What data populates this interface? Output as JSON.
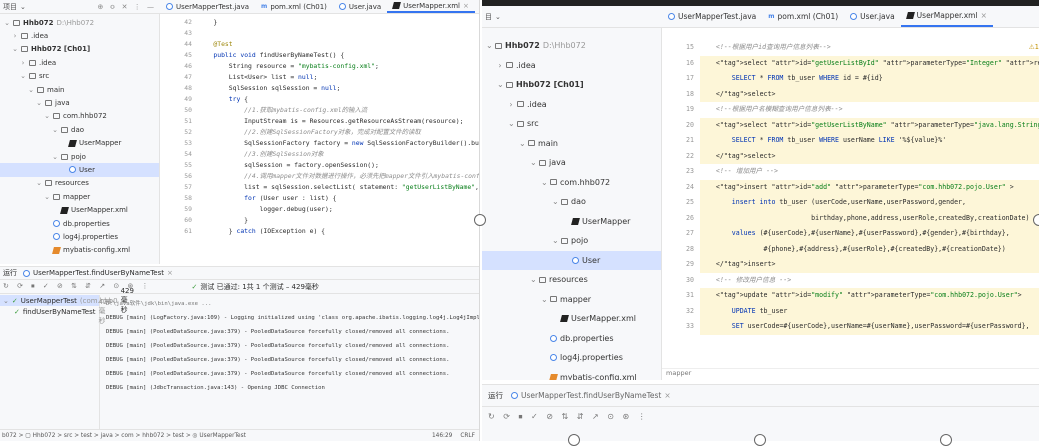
{
  "left": {
    "project_label": "项目",
    "tabs": [
      {
        "label": "UserMapperTest.java",
        "icon": "java-file-icon"
      },
      {
        "label": "pom.xml (Ch01)",
        "icon": "maven-icon"
      },
      {
        "label": "User.java",
        "icon": "java-file-icon"
      },
      {
        "label": "UserMapper.xml",
        "icon": "xml-file-icon"
      }
    ],
    "tree": [
      {
        "label": "Hhb072",
        "extra": "D:\\Hhb072"
      },
      {
        "label": ".idea"
      },
      {
        "label": "Hhb072 [Ch01]"
      },
      {
        "label": ".idea"
      },
      {
        "label": "src"
      },
      {
        "label": "main"
      },
      {
        "label": "java"
      },
      {
        "label": "com.hhb072"
      },
      {
        "label": "dao"
      },
      {
        "label": "UserMapper"
      },
      {
        "label": "pojo"
      },
      {
        "label": "User"
      },
      {
        "label": "resources"
      },
      {
        "label": "mapper"
      },
      {
        "label": "UserMapper.xml"
      },
      {
        "label": "db.properties"
      },
      {
        "label": "log4j.properties"
      },
      {
        "label": "mybatis-config.xml"
      }
    ],
    "gutter": [
      "42",
      "43",
      "44",
      "45",
      "46",
      "47",
      "48",
      "49",
      "50",
      "51",
      "52",
      "53",
      "54",
      "55",
      "56",
      "57",
      "58",
      "59",
      "60",
      "61"
    ],
    "code": [
      "    }",
      "",
      "    @Test",
      "    public void findUserByNameTest() {",
      "        String resource = \"mybatis-config.xml\";",
      "        List<User> list = null;",
      "        SqlSession sqlSession = null;",
      "        try {",
      "            //1.获取mybatis-config.xml的输入流",
      "            InputStream is = Resources.getResourceAsStream(resource);",
      "            //2.创建SqlSessionFactory对象，完成对配置文件的读取",
      "            SqlSessionFactory factory = new SqlSessionFactoryBuilder().build(is);",
      "            //3.创建SqlSession对象",
      "            sqlSession = factory.openSession();",
      "            //4.调用mapper文件对数据进行操作，必须先把mapper文件引入mybatis-config.xml中",
      "            list = sqlSession.selectList( statement: \"getUserListByName\",  parameter: \"张\");",
      "            for (User user : list) {",
      "                logger.debug(user);",
      "            }",
      "        } catch (IOException e) {"
    ],
    "run": {
      "label": "运行",
      "tab": "UserMapperTest.findUserByNameTest",
      "status": "测试 已通过: 1共 1 个测试 – 429毫秒",
      "suite": "UserMapperTest",
      "suite_pkg": "(com.hhb0",
      "suite_time": "429毫秒",
      "test": "findUserByNameTest",
      "test_time": "429毫秒",
      "console": [
        "D:\\java软件\\jdk\\bin\\java.exe ...",
        "DEBUG [main] (LogFactory.java:109) - Logging initialized using 'class org.apache.ibatis.logging.log4j.Log4jImpl' adapter.",
        "DEBUG [main] (PooledDataSource.java:379) - PooledDataSource forcefully closed/removed all connections.",
        "DEBUG [main] (PooledDataSource.java:379) - PooledDataSource forcefully closed/removed all connections.",
        "DEBUG [main] (PooledDataSource.java:379) - PooledDataSource forcefully closed/removed all connections.",
        "DEBUG [main] (PooledDataSource.java:379) - PooledDataSource forcefully closed/removed all connections.",
        "DEBUG [main] (JdbcTransaction.java:143) - Opening JDBC Connection"
      ]
    },
    "status_bar": {
      "path": "b072 > ▢ Hhb072 > src > test > java > com > hhb072 > test > ◎ UserMapperTest",
      "pos": "146:29",
      "enc": "CRLF"
    }
  },
  "right": {
    "project_label": "目",
    "tabs": [
      {
        "label": "UserMapperTest.java",
        "icon": "java-file-icon"
      },
      {
        "label": "pom.xml (Ch01)",
        "icon": "maven-icon"
      },
      {
        "label": "User.java",
        "icon": "java-file-icon"
      },
      {
        "label": "UserMapper.xml",
        "icon": "xml-file-icon"
      }
    ],
    "tree": [
      {
        "label": "Hhb072",
        "extra": "D:\\Hhb072"
      },
      {
        "label": ".idea"
      },
      {
        "label": "Hhb072 [Ch01]"
      },
      {
        "label": ".idea"
      },
      {
        "label": "src"
      },
      {
        "label": "main"
      },
      {
        "label": "java"
      },
      {
        "label": "com.hhb072"
      },
      {
        "label": "dao"
      },
      {
        "label": "UserMapper"
      },
      {
        "label": "pojo"
      },
      {
        "label": "User"
      },
      {
        "label": "resources"
      },
      {
        "label": "mapper"
      },
      {
        "label": "UserMapper.xml"
      },
      {
        "label": "db.properties"
      },
      {
        "label": "log4j.properties"
      },
      {
        "label": "mybatis-config.xml"
      }
    ],
    "gutter": [
      "15",
      "16",
      "17",
      "18",
      "19",
      "20",
      "21",
      "22",
      "23",
      "24",
      "25",
      "26",
      "27",
      "28",
      "29",
      "30",
      "31",
      "32",
      "33"
    ],
    "code": [
      "    <!--根据用户id查询用户信息列表-->",
      "    <select id=\"getUserListById\" parameterType=\"Integer\" resultType=\"com.hhb072.pojo.User\">",
      "        SELECT * FROM tb_user WHERE id = #{id}",
      "    </select>",
      "    <!--根据用户名模糊查询用户信息列表-->",
      "    <select id=\"getUserListByName\" parameterType=\"java.lang.String\" resultType=\"com.hhb072.pojo.User\">",
      "        SELECT * FROM tb_user WHERE userName LIKE '%${value}%'",
      "    </select>",
      "    <!-- 增加用户 -->",
      "    <insert id=\"add\" parameterType=\"com.hhb072.pojo.User\" >",
      "        insert into tb_user (userCode,userName,userPassword,gender,",
      "                            birthday,phone,address,userRole,createdBy,creationDate)",
      "        values (#{userCode},#{userName},#{userPassword},#{gender},#{birthday},",
      "                #{phone},#{address},#{userRole},#{createdBy},#{creationDate})",
      "    </insert>",
      "    <!-- 修改用户信息 -->",
      "    <update id=\"modify\" parameterType=\"com.hhb072.pojo.User\">",
      "        UPDATE tb_user",
      "        SET userCode=#{userCode},userName=#{userName},userPassword=#{userPassword},"
    ],
    "breadcrumb": "mapper",
    "warning": "⚠1",
    "run_label": "运行",
    "run_tab": "UserMapperTest.findUserByNameTest"
  }
}
